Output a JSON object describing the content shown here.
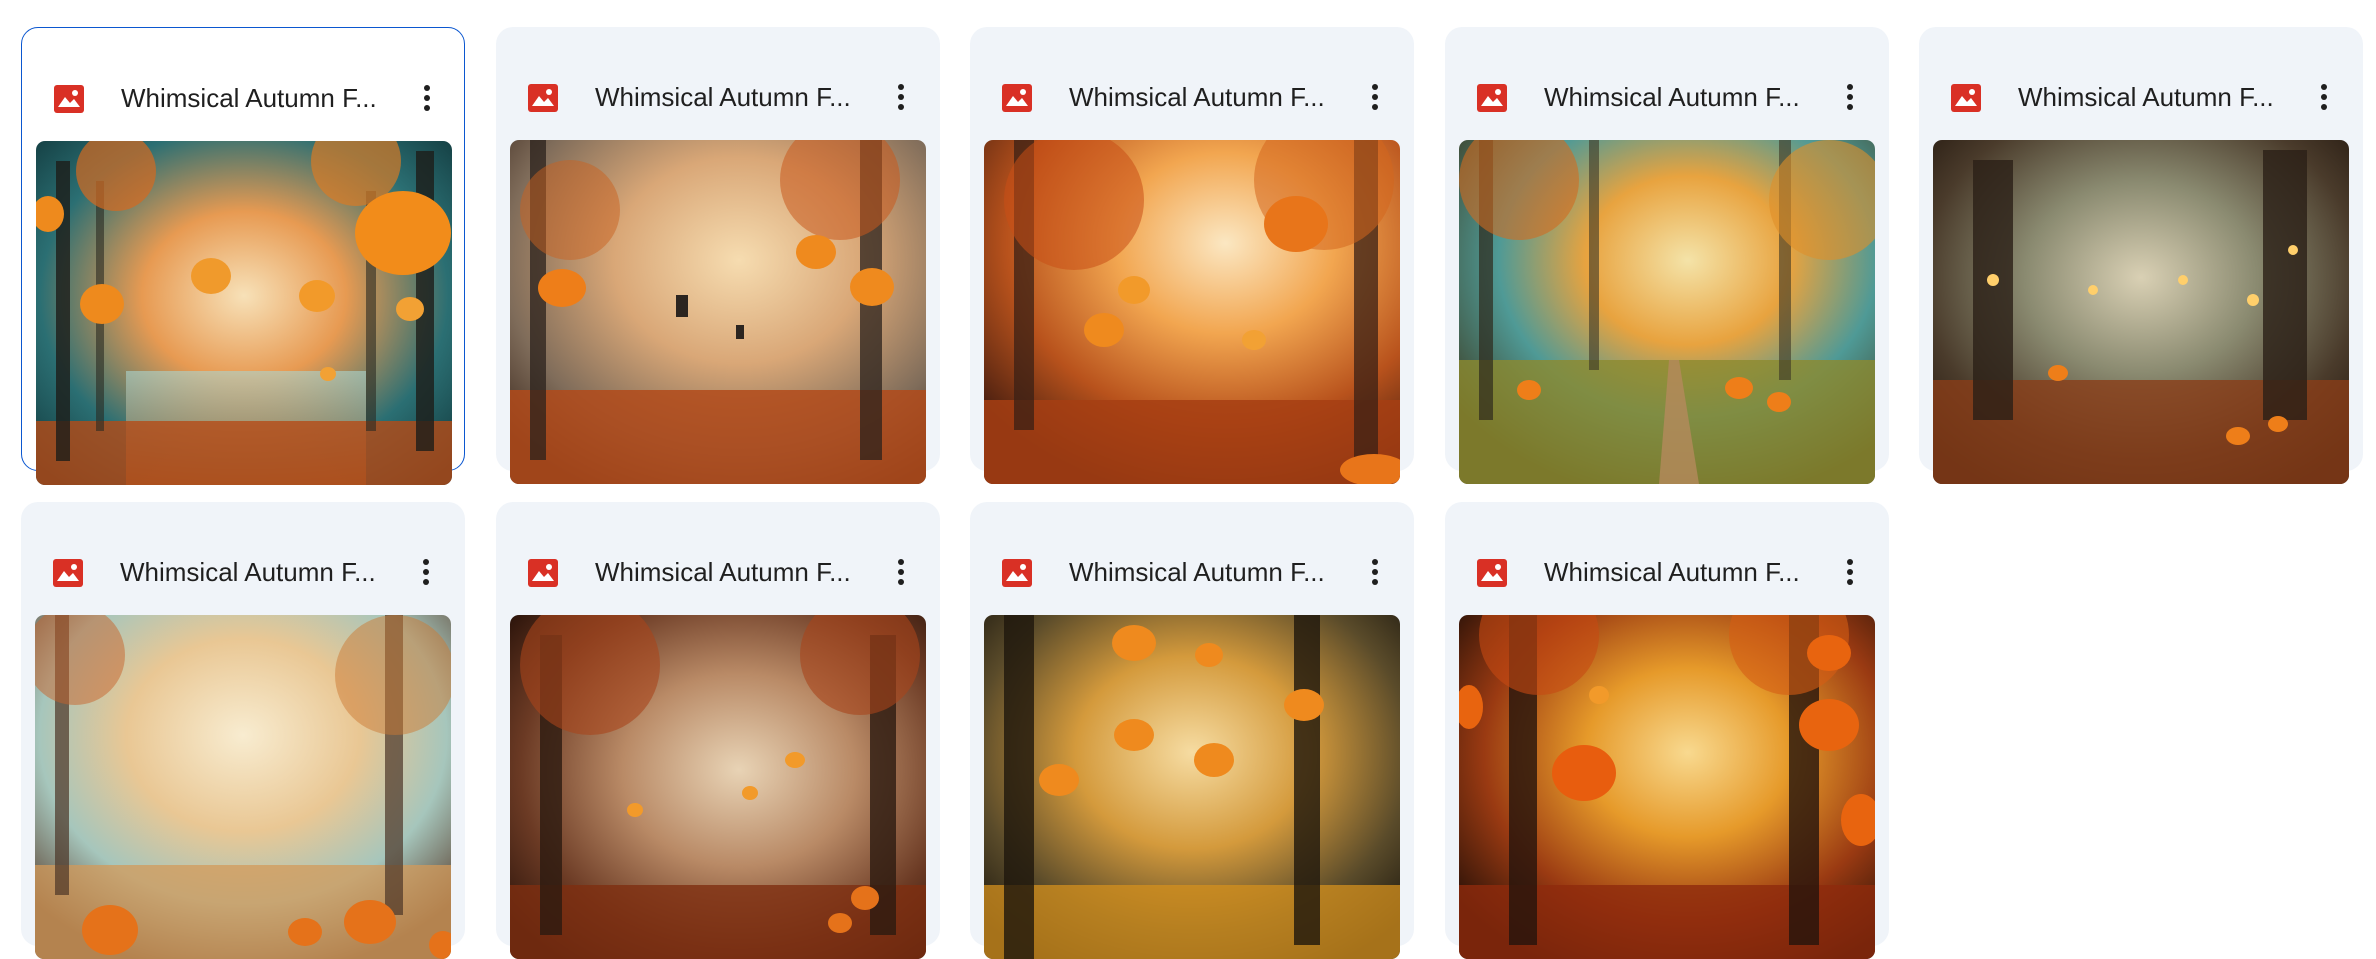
{
  "files": [
    {
      "name": "Whimsical Autumn F...",
      "type_icon": "image-icon",
      "selected": true
    },
    {
      "name": "Whimsical Autumn F...",
      "type_icon": "image-icon",
      "selected": false
    },
    {
      "name": "Whimsical Autumn F...",
      "type_icon": "image-icon",
      "selected": false
    },
    {
      "name": "Whimsical Autumn F...",
      "type_icon": "image-icon",
      "selected": false
    },
    {
      "name": "Whimsical Autumn F...",
      "type_icon": "image-icon",
      "selected": false
    },
    {
      "name": "Whimsical Autumn F...",
      "type_icon": "image-icon",
      "selected": false
    },
    {
      "name": "Whimsical Autumn F...",
      "type_icon": "image-icon",
      "selected": false
    },
    {
      "name": "Whimsical Autumn F...",
      "type_icon": "image-icon",
      "selected": false
    },
    {
      "name": "Whimsical Autumn F...",
      "type_icon": "image-icon",
      "selected": false
    }
  ],
  "colors": {
    "card_bg": "#f0f4f9",
    "selected_border": "#0b57d0",
    "image_icon": "#d93025",
    "title_text": "#1f1f1f"
  }
}
